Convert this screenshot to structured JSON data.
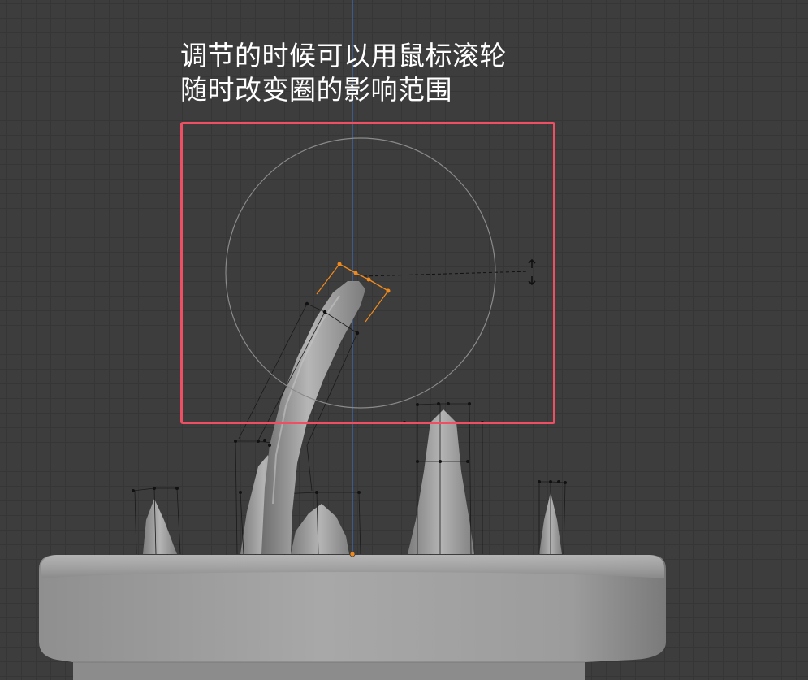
{
  "annotation": {
    "line1": "调节的时候可以用鼠标滚轮",
    "line2": "随时改变圈的影响范围"
  },
  "colors": {
    "viewport_background": "#3d3d3d",
    "grid_line": "#363636",
    "highlight_box": "#ef4f62",
    "axis_line": "#3f6fbf",
    "selected_vertex": "#f08a1c",
    "mesh": "#9a9a9a",
    "proportional_circle": "#8a8a8a",
    "annotation_text": "#ffffff"
  },
  "icons": {
    "resize_cursor": "vertical-resize-arrow-icon",
    "object_origin": "origin-dot-icon"
  }
}
